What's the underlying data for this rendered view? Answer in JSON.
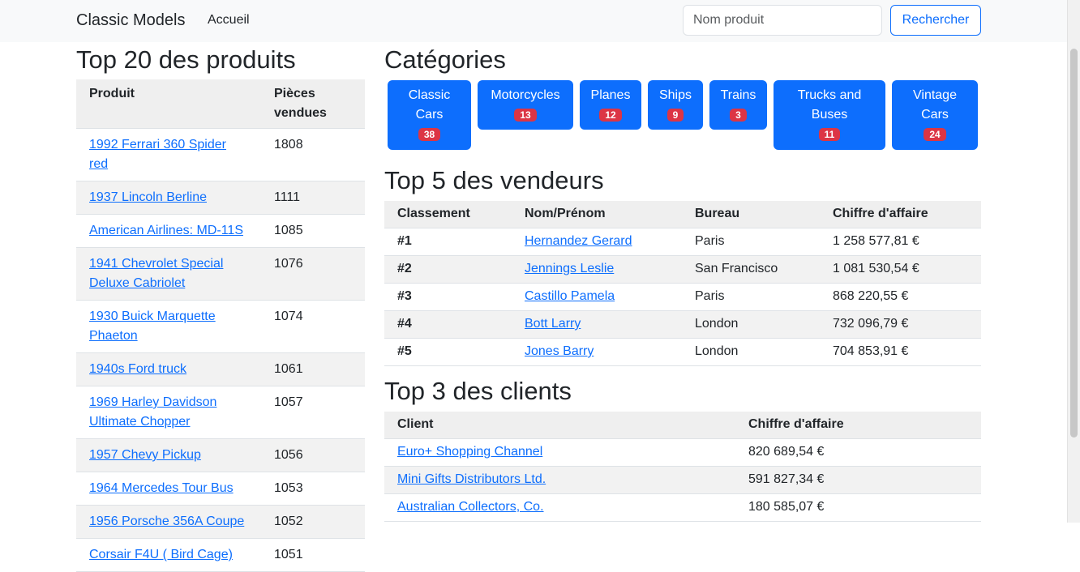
{
  "navbar": {
    "brand": "Classic Models",
    "home": "Accueil",
    "search_placeholder": "Nom produit",
    "search_button": "Rechercher"
  },
  "products": {
    "title": "Top 20 des produits",
    "col_product": "Produit",
    "col_sold": "Pièces vendues",
    "rows": [
      {
        "name": "1992 Ferrari 360 Spider red",
        "sold": "1808"
      },
      {
        "name": "1937 Lincoln Berline",
        "sold": "1111"
      },
      {
        "name": "American Airlines: MD-11S",
        "sold": "1085"
      },
      {
        "name": "1941 Chevrolet Special Deluxe Cabriolet",
        "sold": "1076"
      },
      {
        "name": "1930 Buick Marquette Phaeton",
        "sold": "1074"
      },
      {
        "name": "1940s Ford truck",
        "sold": "1061"
      },
      {
        "name": "1969 Harley Davidson Ultimate Chopper",
        "sold": "1057"
      },
      {
        "name": "1957 Chevy Pickup",
        "sold": "1056"
      },
      {
        "name": "1964 Mercedes Tour Bus",
        "sold": "1053"
      },
      {
        "name": "1956 Porsche 356A Coupe",
        "sold": "1052"
      },
      {
        "name": "Corsair F4U ( Bird Cage)",
        "sold": "1051"
      }
    ]
  },
  "categories": {
    "title": "Catégories",
    "items": [
      {
        "label": "Classic Cars",
        "count": "38"
      },
      {
        "label": "Motorcycles",
        "count": "13"
      },
      {
        "label": "Planes",
        "count": "12"
      },
      {
        "label": "Ships",
        "count": "9"
      },
      {
        "label": "Trains",
        "count": "3"
      },
      {
        "label": "Trucks and Buses",
        "count": "11"
      },
      {
        "label": "Vintage Cars",
        "count": "24"
      }
    ]
  },
  "vendors": {
    "title": "Top 5 des vendeurs",
    "col_rank": "Classement",
    "col_name": "Nom/Prénom",
    "col_office": "Bureau",
    "col_revenue": "Chiffre d'affaire",
    "rows": [
      {
        "rank": "#1",
        "name": "Hernandez Gerard",
        "office": "Paris",
        "revenue": "1 258 577,81 €"
      },
      {
        "rank": "#2",
        "name": "Jennings Leslie",
        "office": "San Francisco",
        "revenue": "1 081 530,54 €"
      },
      {
        "rank": "#3",
        "name": "Castillo Pamela",
        "office": "Paris",
        "revenue": "868 220,55 €"
      },
      {
        "rank": "#4",
        "name": "Bott Larry",
        "office": "London",
        "revenue": "732 096,79 €"
      },
      {
        "rank": "#5",
        "name": "Jones Barry",
        "office": "London",
        "revenue": "704 853,91 €"
      }
    ]
  },
  "clients": {
    "title": "Top 3 des clients",
    "col_client": "Client",
    "col_revenue": "Chiffre d'affaire",
    "rows": [
      {
        "name": "Euro+ Shopping Channel",
        "revenue": "820 689,54 €"
      },
      {
        "name": "Mini Gifts Distributors Ltd.",
        "revenue": "591 827,34 €"
      },
      {
        "name": "Australian Collectors, Co.",
        "revenue": "180 585,07 €"
      }
    ]
  }
}
